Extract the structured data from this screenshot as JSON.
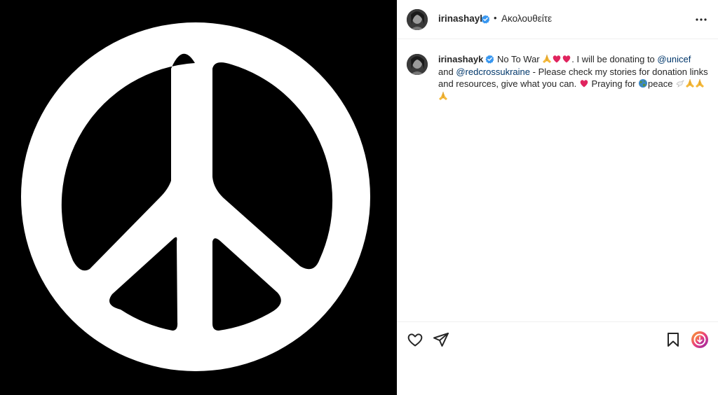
{
  "header": {
    "username": "irinashayk",
    "separator": "•",
    "follow_status": "Ακολουθείτε"
  },
  "caption": {
    "username": "irinashayk",
    "text_1": "No To War",
    "text_2": ". I will be donating to",
    "mention_1": "@unicef",
    "text_3": "and",
    "mention_2": "@redcrossukraine",
    "text_4": "- Please check my stories for donation links and resources, give what you can.",
    "text_5": "Praying for",
    "text_6": "peace"
  },
  "icons": {
    "more": "more-options-icon",
    "like": "heart-icon",
    "share": "paper-plane-icon",
    "save": "bookmark-icon",
    "extension": "download-extension-icon"
  },
  "colors": {
    "verified": "#3897f0",
    "link": "#00376b",
    "heart_emoji": "#e0245e",
    "media_background": "#000000",
    "peace_symbol": "#ffffff"
  }
}
